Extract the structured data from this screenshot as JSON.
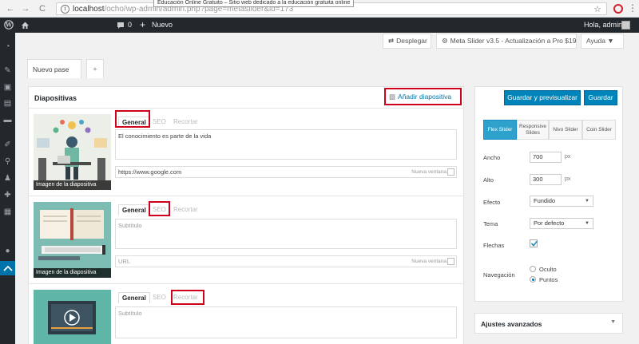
{
  "browser": {
    "back": "←",
    "forward": "→",
    "reload": "C",
    "url_host": "localhost",
    "url_path": "/ocho/wp-admin/admin.php?page=metaslider&id=173",
    "tooltip": "Educación Online Gratuito – Sitio web dedicado a la educación gratuita online",
    "star": "☆",
    "menu": "⋮"
  },
  "admin_bar": {
    "comments_count": "0",
    "new_label": "Nuevo",
    "greeting": "Hola, admin"
  },
  "toolbar": {
    "collapse_label": "Desplegar",
    "update_label": "Meta Slider v3.5 - Actualización a Pro $19",
    "help_label": "Ayuda ▼"
  },
  "tabs": {
    "slideshow_tab": "Nuevo pase",
    "add_tab": "+"
  },
  "slides_panel": {
    "title": "Diapositivas",
    "add_slide": "Añadir diapositiva"
  },
  "slides": [
    {
      "thumb_label": "Imagen de la diapositiva",
      "tab_general": "General",
      "tab_seo": "SEO",
      "tab_crop": "Recortar",
      "caption": "El conocimiento es parte de la vida",
      "url": "https://www.google.com",
      "new_window": "Nueva ventana"
    },
    {
      "thumb_label": "Imagen de la diapositiva",
      "tab_general": "General",
      "tab_seo": "SEO",
      "tab_crop": "Recortar",
      "caption": "Subtítulo",
      "url": "URL",
      "new_window": "Nueva ventana"
    },
    {
      "thumb_label": "Imagen de la diapositiva",
      "tab_general": "General",
      "tab_seo": "SEO",
      "tab_crop": "Recortar",
      "caption": "Subtítulo"
    }
  ],
  "settings": {
    "save_preview": "Guardar y previsualizar",
    "save": "Guardar",
    "slider_types": [
      "Flex Slider",
      "Responsive Slides",
      "Nivo Slider",
      "Coin Slider"
    ],
    "width_label": "Ancho",
    "width_value": "700",
    "height_label": "Alto",
    "height_value": "300",
    "unit": "px",
    "effect_label": "Efecto",
    "effect_value": "Fundido",
    "theme_label": "Tema",
    "theme_value": "Por defecto",
    "arrows_label": "Flechas",
    "navigation_label": "Navegación",
    "nav_hidden": "Oculto",
    "nav_dots": "Puntos",
    "advanced_label": "Ajustes avanzados"
  },
  "colors": {
    "accent": "#0085ba",
    "admin_dark": "#23282d",
    "highlight_red": "#d0021b",
    "active_menu": "#0073aa"
  }
}
